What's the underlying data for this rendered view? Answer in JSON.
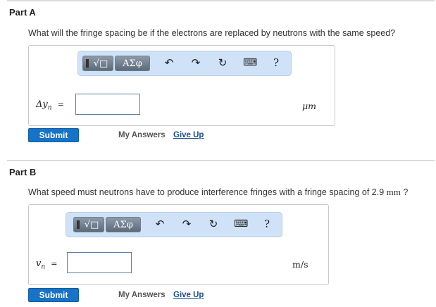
{
  "part_a": {
    "title": "Part A",
    "question": "What will the fringe spacing be if the electrons are replaced by neutrons with the same speed?",
    "variable_label": "Δy",
    "variable_subscript": "n",
    "equals": "=",
    "input_value": "",
    "unit": "μm",
    "submit_label": "Submit",
    "my_answers_label": "My Answers",
    "give_up_label": "Give Up"
  },
  "part_b": {
    "title": "Part B",
    "question_text": "What speed must neutrons have to produce interference fringes with a fringe spacing of 2.9",
    "question_unit": "mm",
    "question_end": "?",
    "variable_label": "v",
    "variable_subscript": "n",
    "equals": "=",
    "input_value": "",
    "unit": "m/s",
    "submit_label": "Submit",
    "my_answers_label": "My Answers",
    "give_up_label": "Give Up"
  },
  "toolbar": {
    "templates_label": "√□",
    "symbols_label": "ΑΣφ",
    "undo_icon": "↶",
    "redo_icon": "↷",
    "reset_icon": "↻",
    "keyboard_icon": "⌨",
    "help_label": "?"
  },
  "colors": {
    "submit": "#1773c7",
    "toolbar": "#cfe2f7",
    "link": "#1d4f8e"
  }
}
